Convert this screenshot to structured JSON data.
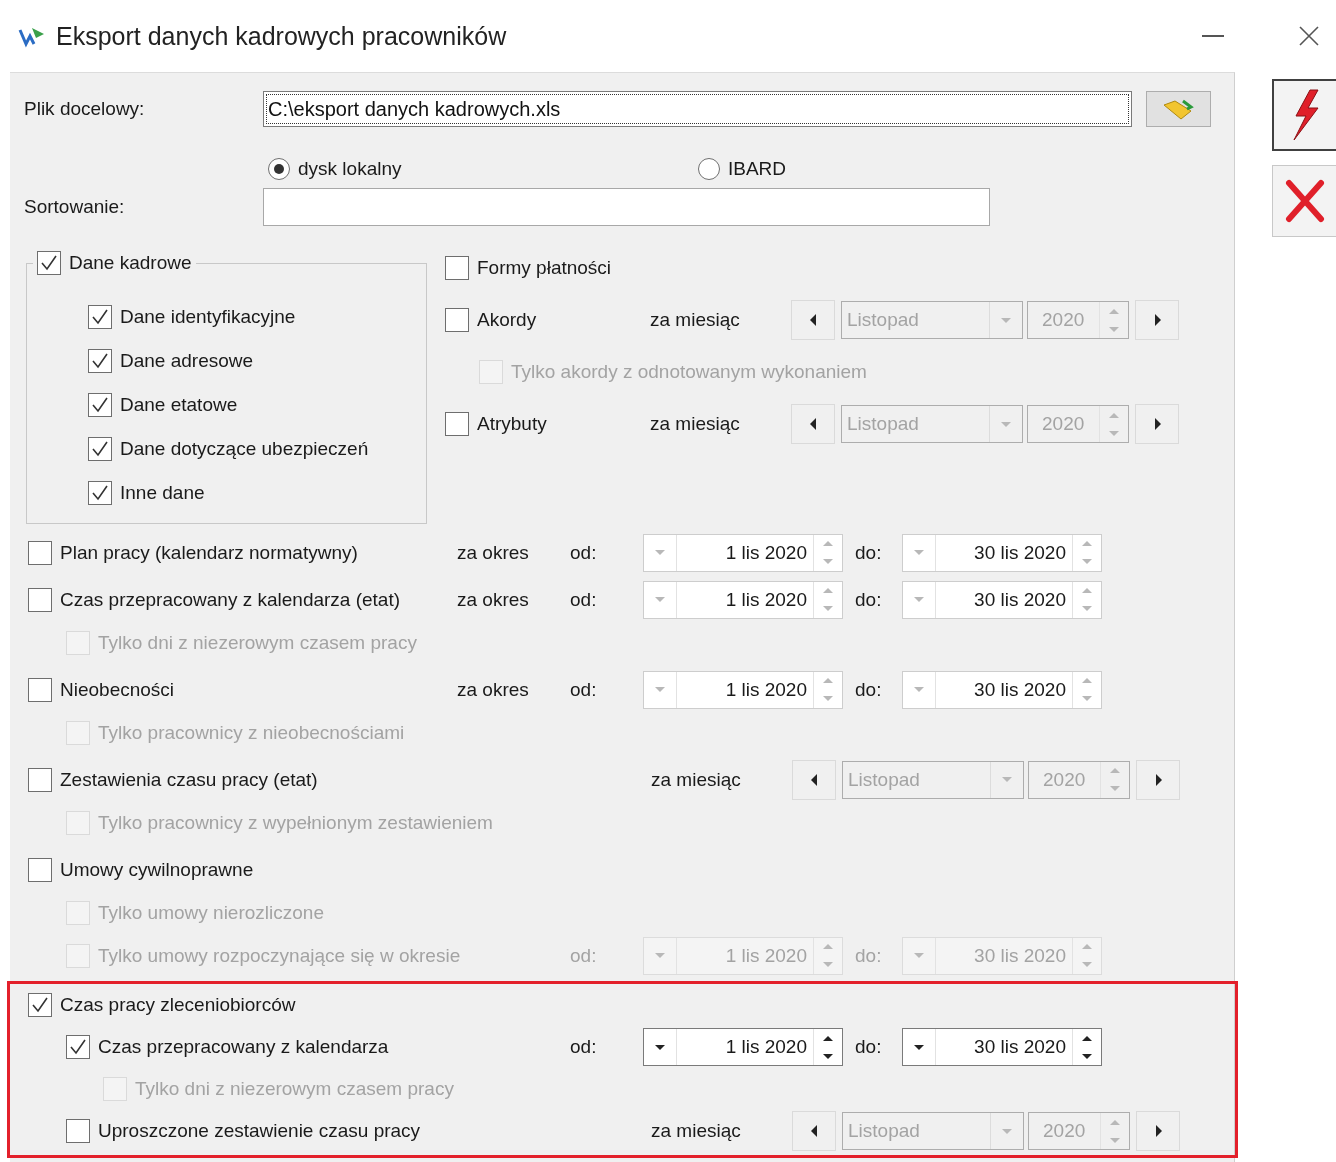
{
  "window": {
    "title": "Eksport danych kadrowych pracowników"
  },
  "target_file": {
    "label": "Plik docelowy:",
    "value": "C:\\eksport danych kadrowych.xls"
  },
  "storage": [
    {
      "label": "dysk lokalny",
      "selected": true
    },
    {
      "label": "IBARD",
      "selected": false
    }
  ],
  "sorting": {
    "label": "Sortowanie:"
  },
  "personnel_data": {
    "label": "Dane kadrowe",
    "checked": true,
    "items": [
      {
        "label": "Dane identyfikacyjne",
        "checked": true
      },
      {
        "label": "Dane adresowe",
        "checked": true
      },
      {
        "label": "Dane etatowe",
        "checked": true
      },
      {
        "label": "Dane dotyczące ubezpieczeń",
        "checked": true
      },
      {
        "label": "Inne dane",
        "checked": true
      }
    ]
  },
  "right_options": [
    {
      "label": "Formy płatności",
      "checked": false,
      "disabled": false
    },
    {
      "label": "Akordy",
      "checked": false,
      "disabled": false,
      "period": {
        "kind": "month",
        "prefix": "za miesiąc",
        "month": "Listopad",
        "year": "2020",
        "disabled": true
      },
      "children": [
        {
          "label": "Tylko akordy z odnotowanym wykonaniem",
          "checked": false,
          "disabled": true
        }
      ]
    },
    {
      "label": "Atrybuty",
      "checked": false,
      "disabled": false,
      "period": {
        "kind": "month",
        "prefix": "za miesiąc",
        "month": "Listopad",
        "year": "2020",
        "disabled": true
      }
    }
  ],
  "sections": [
    {
      "label": "Plan pracy (kalendarz normatywny)",
      "checked": false,
      "disabled": false,
      "highlighted": false,
      "period": {
        "kind": "range",
        "prefix": "za okres",
        "from_label": "od:",
        "from": "1 lis 2020",
        "to_label": "do:",
        "to": "30 lis 2020",
        "disabled": false,
        "active": false
      }
    },
    {
      "label": "Czas przepracowany z kalendarza (etat)",
      "checked": false,
      "disabled": false,
      "highlighted": false,
      "period": {
        "kind": "range",
        "prefix": "za okres",
        "from_label": "od:",
        "from": "1 lis 2020",
        "to_label": "do:",
        "to": "30 lis 2020",
        "disabled": false,
        "active": false
      },
      "children": [
        {
          "label": "Tylko dni z niezerowym czasem pracy",
          "checked": false,
          "disabled": true
        }
      ]
    },
    {
      "label": "Nieobecności",
      "checked": false,
      "disabled": false,
      "highlighted": false,
      "period": {
        "kind": "range",
        "prefix": "za okres",
        "from_label": "od:",
        "from": "1 lis 2020",
        "to_label": "do:",
        "to": "30 lis 2020",
        "disabled": false,
        "active": false
      },
      "children": [
        {
          "label": "Tylko pracownicy z nieobecnościami",
          "checked": false,
          "disabled": true
        }
      ]
    },
    {
      "label": "Zestawienia czasu pracy (etat)",
      "checked": false,
      "disabled": false,
      "highlighted": false,
      "period": {
        "kind": "month",
        "prefix": "za miesiąc",
        "month": "Listopad",
        "year": "2020",
        "disabled": true
      },
      "children": [
        {
          "label": "Tylko pracownicy z wypełnionym zestawieniem",
          "checked": false,
          "disabled": true
        }
      ]
    },
    {
      "label": "Umowy cywilnoprawne",
      "checked": false,
      "disabled": false,
      "highlighted": false,
      "children": [
        {
          "label": "Tylko umowy nierozliczone",
          "checked": false,
          "disabled": true
        },
        {
          "label": "Tylko umowy rozpoczynające się w okresie",
          "checked": false,
          "disabled": true,
          "period": {
            "kind": "range",
            "from_label": "od:",
            "from": "1 lis 2020",
            "to_label": "do:",
            "to": "30 lis 2020",
            "disabled": true,
            "active": false
          }
        }
      ]
    },
    {
      "label": "Czas pracy zleceniobiorców",
      "checked": true,
      "disabled": false,
      "highlighted": true,
      "children": [
        {
          "label": "Czas przepracowany z kalendarza",
          "checked": true,
          "disabled": false,
          "period": {
            "kind": "range",
            "from_label": "od:",
            "from": "1 lis 2020",
            "to_label": "do:",
            "to": "30 lis 2020",
            "disabled": false,
            "active": true
          },
          "children": [
            {
              "label": "Tylko dni z niezerowym czasem pracy",
              "checked": false,
              "disabled": true
            }
          ]
        },
        {
          "label": "Uproszczone zestawienie czasu pracy",
          "checked": false,
          "disabled": false,
          "period": {
            "kind": "month",
            "prefix": "za miesiąc",
            "month": "Listopad",
            "year": "2020",
            "disabled": true
          }
        }
      ]
    }
  ]
}
